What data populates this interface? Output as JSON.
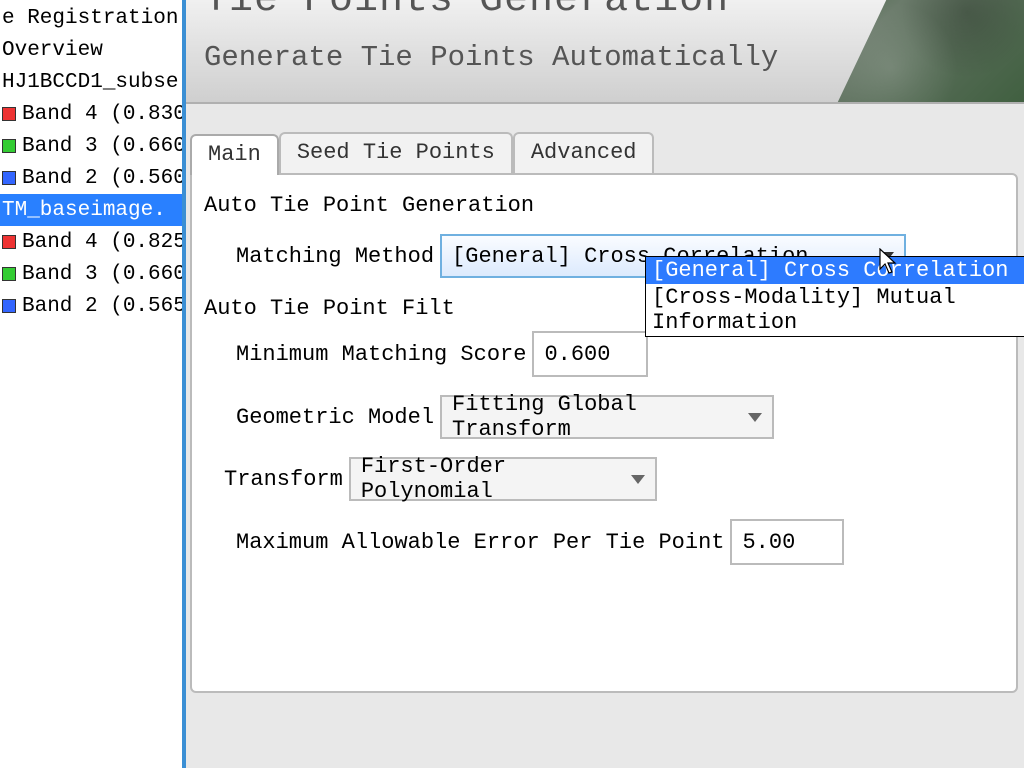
{
  "sidebar": {
    "items": [
      {
        "label": "e Registration"
      },
      {
        "label": "Overview"
      },
      {
        "label": "HJ1BCCD1_subse"
      },
      {
        "label": "Band 4 (0.830",
        "sq": "red"
      },
      {
        "label": "Band 3 (0.660",
        "sq": "green"
      },
      {
        "label": "Band 2 (0.560",
        "sq": "blue"
      },
      {
        "label": "TM_baseimage.",
        "selected": true
      },
      {
        "label": "Band 4 (0.825",
        "sq": "red"
      },
      {
        "label": "Band 3 (0.660",
        "sq": "green"
      },
      {
        "label": "Band 2 (0.565",
        "sq": "blue"
      }
    ]
  },
  "header": {
    "title": "Tie Points Generation",
    "subtitle": "Generate Tie Points Automatically"
  },
  "tabs": {
    "main": "Main",
    "seed": "Seed Tie Points",
    "advanced": "Advanced"
  },
  "panel": {
    "section1": "Auto Tie Point Generation",
    "matching_method_label": "Matching Method",
    "matching_method_value": "[General] Cross Correlation",
    "dropdown_options": [
      "[General] Cross Correlation",
      "[Cross-Modality] Mutual Information"
    ],
    "section2": "Auto Tie Point Filt",
    "min_score_label": "Minimum Matching Score",
    "min_score_value": "0.600",
    "geo_model_label": "Geometric Model",
    "geo_model_value": "Fitting Global Transform",
    "transform_label": "Transform",
    "transform_value": "First-Order Polynomial",
    "max_err_label": "Maximum Allowable Error Per Tie Point",
    "max_err_value": "5.00"
  }
}
